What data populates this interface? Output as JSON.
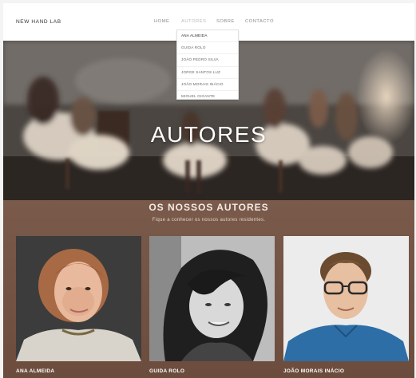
{
  "header": {
    "brand": "NEW HAND LAB",
    "nav": [
      {
        "label": "HOME",
        "active": false
      },
      {
        "label": "AUTORES",
        "active": true
      },
      {
        "label": "SOBRE",
        "active": false
      },
      {
        "label": "CONTACTO",
        "active": false
      }
    ],
    "dropdown": [
      "ANA ALMEIDA",
      "GUIDA ROLO",
      "JOÃO PEDRO SILVA",
      "JORGE SANTOS LUZ",
      "JOÃO MORAIS INÁCIO",
      "MIGUEL GIGANTE"
    ]
  },
  "hero": {
    "title": "AUTORES"
  },
  "authors": {
    "title": "OS NOSSOS AUTORES",
    "subtitle": "Fique a conhecer os nossos autores residentes.",
    "cards": [
      {
        "name": "ANA ALMEIDA"
      },
      {
        "name": "GUIDA ROLO"
      },
      {
        "name": "JOÃO MORAIS INÁCIO"
      }
    ]
  },
  "colors": {
    "section_bg": "#6e4f40",
    "header_bg": "#ffffff",
    "accent_text": "#f4ece6"
  }
}
